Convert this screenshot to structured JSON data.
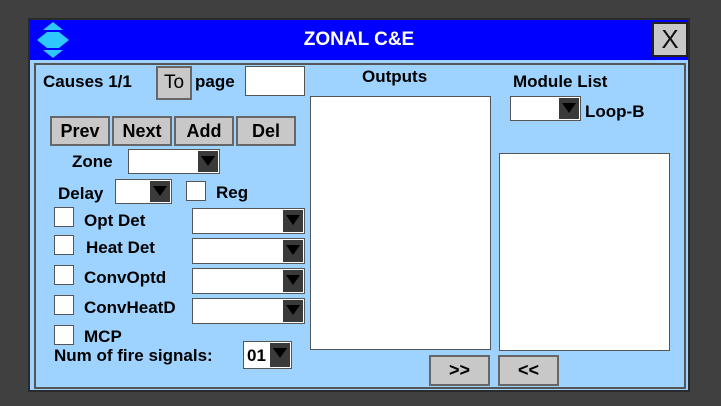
{
  "window": {
    "title": "ZONAL C&E",
    "close_label": "X"
  },
  "causes": {
    "label": "Causes 1/1",
    "to_label": "To",
    "page_label": "page",
    "page_value": ""
  },
  "nav": {
    "prev": "Prev",
    "next": "Next",
    "add": "Add",
    "del": "Del"
  },
  "zone": {
    "label": "Zone",
    "value": ""
  },
  "delay": {
    "label": "Delay",
    "value": ""
  },
  "reg": {
    "label": "Reg"
  },
  "detectors": [
    {
      "label": "Opt Det",
      "value": ""
    },
    {
      "label": "Heat Det",
      "value": ""
    },
    {
      "label": "ConvOptd",
      "value": ""
    },
    {
      "label": "ConvHeatD",
      "value": ""
    }
  ],
  "mcp": {
    "label": "MCP"
  },
  "fire_signals": {
    "label": "Num of fire signals:",
    "value": "01"
  },
  "outputs": {
    "label": "Outputs"
  },
  "module_list": {
    "label": "Module List",
    "loop_label": "Loop-B",
    "value": ""
  },
  "transfer": {
    "add": ">>",
    "remove": "<<"
  },
  "colors": {
    "titlebar": "#0000ff",
    "panel": "#9fd3ff",
    "button": "#c8c8c8"
  }
}
